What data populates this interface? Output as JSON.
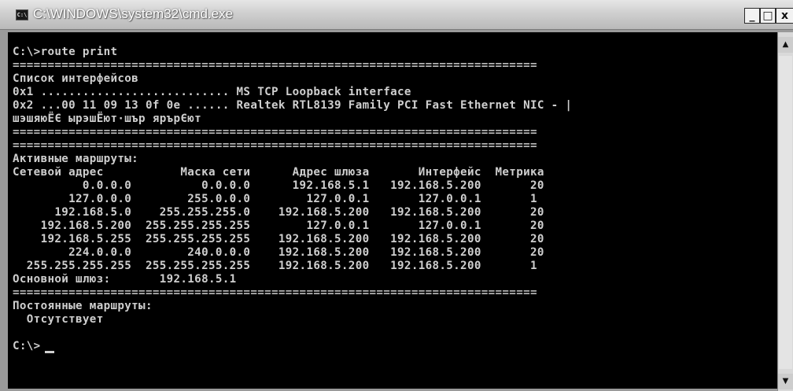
{
  "window": {
    "title": "C:\\WINDOWS\\system32\\cmd.exe",
    "icon_text": "C:\\",
    "minimize_glyph": "_",
    "maximize_glyph": "□",
    "close_glyph": "x"
  },
  "console": {
    "lines": [
      "C:\\>route print",
      "===========================================================================",
      "Список интерфейсов",
      "0x1 ........................... MS TCP Loopback interface",
      "0x2 ...00 11 09 13 0f 0e ...... Realtek RTL8139 Family PCI Fast Ethernet NIC - |",
      "шэшяюЁЄ ырэшЁют·шър ярърЄют",
      "===========================================================================",
      "===========================================================================",
      "Активные маршруты:",
      "Сетевой адрес           Маска сети      Адрес шлюза       Интерфейс  Метрика",
      "          0.0.0.0          0.0.0.0      192.168.5.1   192.168.5.200       20",
      "        127.0.0.0        255.0.0.0        127.0.0.1       127.0.0.1       1",
      "      192.168.5.0    255.255.255.0    192.168.5.200   192.168.5.200       20",
      "    192.168.5.200  255.255.255.255        127.0.0.1       127.0.0.1       20",
      "    192.168.5.255  255.255.255.255    192.168.5.200   192.168.5.200       20",
      "        224.0.0.0        240.0.0.0    192.168.5.200   192.168.5.200       20",
      "  255.255.255.255  255.255.255.255    192.168.5.200   192.168.5.200       1",
      "Основной шлюз:       192.168.5.1",
      "===========================================================================",
      "Постоянные маршруты:",
      "  Отсутствует",
      "",
      "C:\\>"
    ]
  },
  "scrollbar": {
    "up_glyph": "▲",
    "down_glyph": "▼"
  }
}
